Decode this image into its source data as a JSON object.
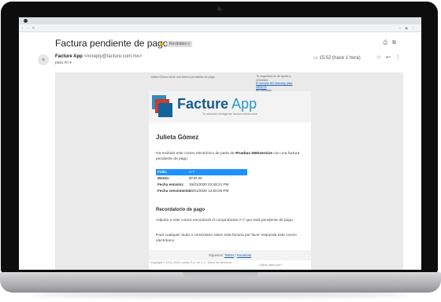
{
  "email": {
    "subject": "Factura pendiente de pago.",
    "label": "Recibidos x",
    "sender_name": "Facture App",
    "sender_email": "<noreply@facture.com.mx>",
    "to": "para mí",
    "time": "15:52 (hace 1 hora)"
  },
  "preheader": {
    "left": "Julieta Gómez tiene una factura pendiente de pago.",
    "right_text": "Tu seguridad es de ayuda y velocidad.",
    "right_link_1": "El llamado Bill Saturday pilas MBMOS",
    "right_link_2": "Bill Manager"
  },
  "brand": {
    "name": "Facture",
    "name_suffix": " App",
    "tagline": "Tu solución inteligente factura electrónica"
  },
  "body": {
    "greeting": "Julieta Gómez",
    "intro_before": "Ha recibido este correo electrónico de parte de ",
    "intro_company": "Pruebas Webservice",
    "intro_after": " con una factura pendiente de pago.",
    "details": [
      {
        "label": "Folio:",
        "value": "A-7"
      },
      {
        "label": "Monto:",
        "value": "$720.00"
      },
      {
        "label": "Fecha emisión:",
        "value": "15/01/2020 02:48:21 PM"
      },
      {
        "label": "Fecha vencimiento:",
        "value": "16/01/2020 12:00:00 PM"
      }
    ],
    "reminder_title": "Recordatorio de pago",
    "reminder_text_1": "Adjunto a este correo encontrará el comprobante A-7 que está pendiente de pago.",
    "reminder_text_2": "Para cualquier duda o comentario sobre esta factura por favor responda este correo electrónico."
  },
  "footer": {
    "follow_prefix": "Síguenos: ",
    "twitter": "Twitter",
    "separator": " | ",
    "facebook": "Facebook",
    "copyright": "Copyright © 2011-2020 Londeo S.A. de C.V.. Todos los derechos",
    "did_you_know": "¿Sabía usted que?"
  },
  "colors": {
    "accent": "#1e90ff",
    "brand_blue": "#165b8c",
    "brand_light": "#2a9ad2",
    "label_arrow": "#f2b400"
  }
}
